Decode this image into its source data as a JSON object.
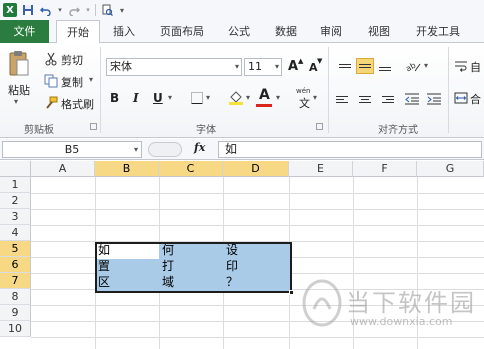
{
  "quick_access": {
    "icons": [
      "excel-logo",
      "save-icon",
      "undo-icon",
      "redo-icon",
      "customize-icon"
    ]
  },
  "ribbon_tabs": [
    {
      "label": "文件"
    },
    {
      "label": "开始"
    },
    {
      "label": "插入"
    },
    {
      "label": "页面布局"
    },
    {
      "label": "公式"
    },
    {
      "label": "数据"
    },
    {
      "label": "审阅"
    },
    {
      "label": "视图"
    },
    {
      "label": "开发工具"
    }
  ],
  "clipboard": {
    "paste": "粘贴",
    "cut": "剪切",
    "copy": "复制",
    "format_painter": "格式刷",
    "group_label": "剪贴板"
  },
  "font": {
    "font_name": "宋体",
    "font_size": "11",
    "bold": "B",
    "italic": "I",
    "underline": "U",
    "grow": "A",
    "shrink": "A",
    "color_a": "A",
    "wen": "wén",
    "wen_char": "文",
    "group_label": "字体",
    "font_color": "#d8271c",
    "highlight_color": "#f6e23a"
  },
  "alignment": {
    "group_label": "对齐方式",
    "wrap_fragment": "自",
    "merge_fragment": "合"
  },
  "formula_bar": {
    "name_box": "B5",
    "fx": "fx",
    "content": "如"
  },
  "columns": [
    "A",
    "B",
    "C",
    "D",
    "E",
    "F",
    "G"
  ],
  "rows": [
    "1",
    "2",
    "3",
    "4",
    "5",
    "6",
    "7",
    "8",
    "9",
    "10"
  ],
  "selected_columns": [
    "B",
    "C",
    "D"
  ],
  "selected_rows": [
    "5",
    "6",
    "7"
  ],
  "cells": {
    "B5": "如",
    "C5": "何",
    "D5": "设",
    "B6": "置",
    "C6": "打",
    "D6": "印",
    "B7": "区",
    "C7": "域",
    "D7": "？"
  },
  "watermark": {
    "text": "当下软件园",
    "url": "www.downxia.com"
  },
  "colors": {
    "accent_green": "#2a7d3e",
    "selection_fill": "#a9cbe8",
    "header_highlight": "#f6d885"
  }
}
